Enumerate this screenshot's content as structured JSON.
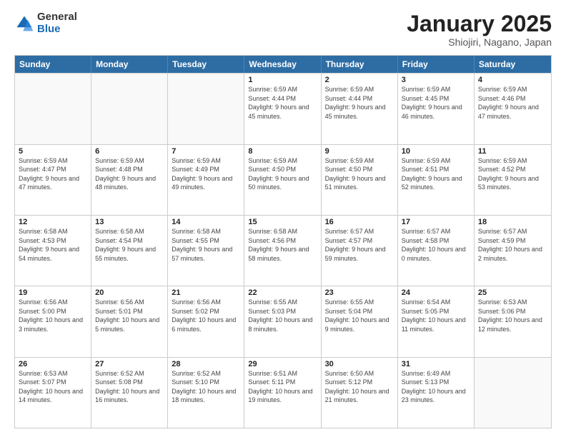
{
  "logo": {
    "general": "General",
    "blue": "Blue"
  },
  "title": "January 2025",
  "location": "Shiojiri, Nagano, Japan",
  "header_days": [
    "Sunday",
    "Monday",
    "Tuesday",
    "Wednesday",
    "Thursday",
    "Friday",
    "Saturday"
  ],
  "weeks": [
    [
      {
        "day": "",
        "info": ""
      },
      {
        "day": "",
        "info": ""
      },
      {
        "day": "",
        "info": ""
      },
      {
        "day": "1",
        "info": "Sunrise: 6:59 AM\nSunset: 4:44 PM\nDaylight: 9 hours and 45 minutes."
      },
      {
        "day": "2",
        "info": "Sunrise: 6:59 AM\nSunset: 4:44 PM\nDaylight: 9 hours and 45 minutes."
      },
      {
        "day": "3",
        "info": "Sunrise: 6:59 AM\nSunset: 4:45 PM\nDaylight: 9 hours and 46 minutes."
      },
      {
        "day": "4",
        "info": "Sunrise: 6:59 AM\nSunset: 4:46 PM\nDaylight: 9 hours and 47 minutes."
      }
    ],
    [
      {
        "day": "5",
        "info": "Sunrise: 6:59 AM\nSunset: 4:47 PM\nDaylight: 9 hours and 47 minutes."
      },
      {
        "day": "6",
        "info": "Sunrise: 6:59 AM\nSunset: 4:48 PM\nDaylight: 9 hours and 48 minutes."
      },
      {
        "day": "7",
        "info": "Sunrise: 6:59 AM\nSunset: 4:49 PM\nDaylight: 9 hours and 49 minutes."
      },
      {
        "day": "8",
        "info": "Sunrise: 6:59 AM\nSunset: 4:50 PM\nDaylight: 9 hours and 50 minutes."
      },
      {
        "day": "9",
        "info": "Sunrise: 6:59 AM\nSunset: 4:50 PM\nDaylight: 9 hours and 51 minutes."
      },
      {
        "day": "10",
        "info": "Sunrise: 6:59 AM\nSunset: 4:51 PM\nDaylight: 9 hours and 52 minutes."
      },
      {
        "day": "11",
        "info": "Sunrise: 6:59 AM\nSunset: 4:52 PM\nDaylight: 9 hours and 53 minutes."
      }
    ],
    [
      {
        "day": "12",
        "info": "Sunrise: 6:58 AM\nSunset: 4:53 PM\nDaylight: 9 hours and 54 minutes."
      },
      {
        "day": "13",
        "info": "Sunrise: 6:58 AM\nSunset: 4:54 PM\nDaylight: 9 hours and 55 minutes."
      },
      {
        "day": "14",
        "info": "Sunrise: 6:58 AM\nSunset: 4:55 PM\nDaylight: 9 hours and 57 minutes."
      },
      {
        "day": "15",
        "info": "Sunrise: 6:58 AM\nSunset: 4:56 PM\nDaylight: 9 hours and 58 minutes."
      },
      {
        "day": "16",
        "info": "Sunrise: 6:57 AM\nSunset: 4:57 PM\nDaylight: 9 hours and 59 minutes."
      },
      {
        "day": "17",
        "info": "Sunrise: 6:57 AM\nSunset: 4:58 PM\nDaylight: 10 hours and 0 minutes."
      },
      {
        "day": "18",
        "info": "Sunrise: 6:57 AM\nSunset: 4:59 PM\nDaylight: 10 hours and 2 minutes."
      }
    ],
    [
      {
        "day": "19",
        "info": "Sunrise: 6:56 AM\nSunset: 5:00 PM\nDaylight: 10 hours and 3 minutes."
      },
      {
        "day": "20",
        "info": "Sunrise: 6:56 AM\nSunset: 5:01 PM\nDaylight: 10 hours and 5 minutes."
      },
      {
        "day": "21",
        "info": "Sunrise: 6:56 AM\nSunset: 5:02 PM\nDaylight: 10 hours and 6 minutes."
      },
      {
        "day": "22",
        "info": "Sunrise: 6:55 AM\nSunset: 5:03 PM\nDaylight: 10 hours and 8 minutes."
      },
      {
        "day": "23",
        "info": "Sunrise: 6:55 AM\nSunset: 5:04 PM\nDaylight: 10 hours and 9 minutes."
      },
      {
        "day": "24",
        "info": "Sunrise: 6:54 AM\nSunset: 5:05 PM\nDaylight: 10 hours and 11 minutes."
      },
      {
        "day": "25",
        "info": "Sunrise: 6:53 AM\nSunset: 5:06 PM\nDaylight: 10 hours and 12 minutes."
      }
    ],
    [
      {
        "day": "26",
        "info": "Sunrise: 6:53 AM\nSunset: 5:07 PM\nDaylight: 10 hours and 14 minutes."
      },
      {
        "day": "27",
        "info": "Sunrise: 6:52 AM\nSunset: 5:08 PM\nDaylight: 10 hours and 16 minutes."
      },
      {
        "day": "28",
        "info": "Sunrise: 6:52 AM\nSunset: 5:10 PM\nDaylight: 10 hours and 18 minutes."
      },
      {
        "day": "29",
        "info": "Sunrise: 6:51 AM\nSunset: 5:11 PM\nDaylight: 10 hours and 19 minutes."
      },
      {
        "day": "30",
        "info": "Sunrise: 6:50 AM\nSunset: 5:12 PM\nDaylight: 10 hours and 21 minutes."
      },
      {
        "day": "31",
        "info": "Sunrise: 6:49 AM\nSunset: 5:13 PM\nDaylight: 10 hours and 23 minutes."
      },
      {
        "day": "",
        "info": ""
      }
    ]
  ]
}
